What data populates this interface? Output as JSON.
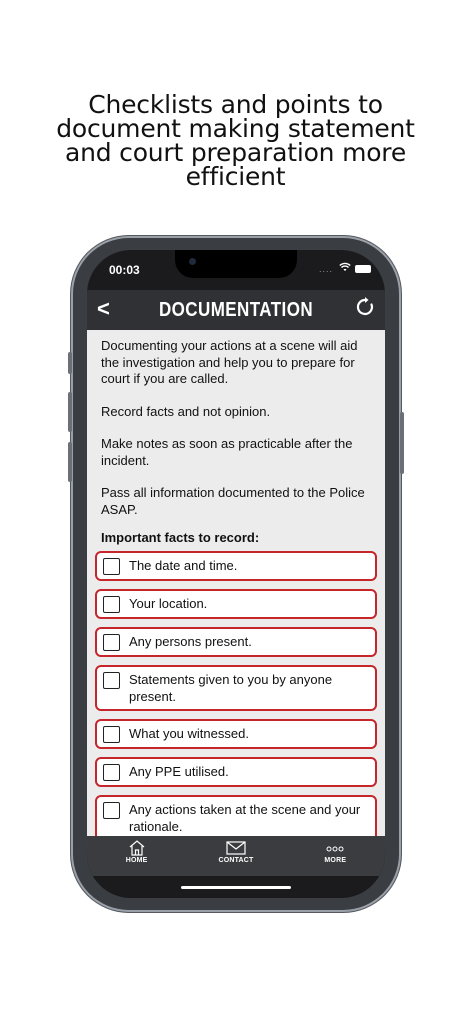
{
  "headline": {
    "lines": [
      "Checklists and points to",
      "document making statement",
      "and court preparation more",
      "efficient"
    ]
  },
  "status_bar": {
    "time": "00:03",
    "signal": "...."
  },
  "navbar": {
    "back": "<",
    "title": "DOCUMENTATION"
  },
  "content": {
    "paragraphs": [
      "Documenting your actions at a scene will aid the investigation and help you to prepare for court if you are called.",
      "Record facts and not opinion.",
      "Make notes as soon as practicable after the incident.",
      "Pass all information documented to the Police ASAP."
    ],
    "subheading": "Important facts to record:",
    "checklist": [
      "The date and time.",
      "Your location.",
      "Any persons present.",
      "Statements given to you by anyone present.",
      "What you witnessed.",
      "Any PPE utilised.",
      "Any actions taken at the scene and your rationale."
    ]
  },
  "tabbar": {
    "home": "HOME",
    "contact": "CONTACT",
    "more": "MORE"
  },
  "colors": {
    "accent_border": "#c5262b",
    "navbar": "#303134",
    "content_bg": "#ececec"
  },
  "icons": [
    "back-chevron-icon",
    "refresh-icon",
    "home-icon",
    "envelope-icon",
    "more-dots-icon"
  ]
}
